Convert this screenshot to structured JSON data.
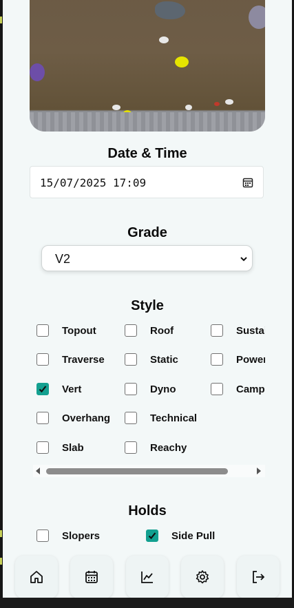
{
  "date_section": {
    "title": "Date & Time",
    "value": "15/07/2025 17:09"
  },
  "grade_section": {
    "title": "Grade",
    "selected": "V2"
  },
  "style_section": {
    "title": "Style",
    "options": [
      {
        "label": "Topout",
        "checked": false
      },
      {
        "label": "Roof",
        "checked": false
      },
      {
        "label": "Sustained",
        "checked": false
      },
      {
        "label": "Traverse",
        "checked": false
      },
      {
        "label": "Static",
        "checked": false
      },
      {
        "label": "Power",
        "checked": false
      },
      {
        "label": "Vert",
        "checked": true
      },
      {
        "label": "Dyno",
        "checked": false
      },
      {
        "label": "Campus",
        "checked": false
      },
      {
        "label": "Overhang",
        "checked": false
      },
      {
        "label": "Technical",
        "checked": false
      },
      {
        "label": "Slab",
        "checked": false
      },
      {
        "label": "Reachy",
        "checked": false
      }
    ]
  },
  "holds_section": {
    "title": "Holds",
    "options": [
      {
        "label": "Slopers",
        "checked": false
      },
      {
        "label": "Side Pull",
        "checked": true
      }
    ]
  },
  "nav": {
    "items": [
      {
        "icon": "home-icon"
      },
      {
        "icon": "calendar-icon"
      },
      {
        "icon": "chart-icon"
      },
      {
        "icon": "settings-icon"
      },
      {
        "icon": "logout-icon"
      }
    ]
  },
  "colors": {
    "accent": "#13a090",
    "background": "#f3f8f8"
  }
}
